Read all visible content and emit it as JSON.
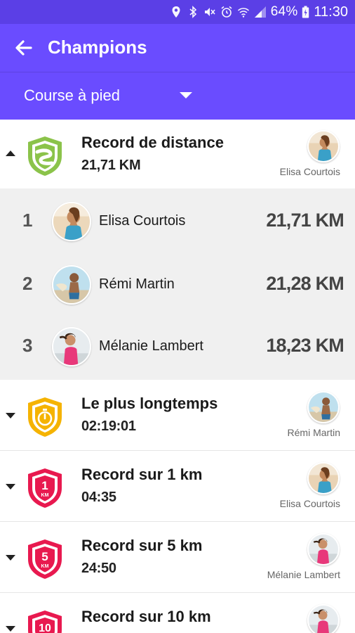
{
  "status_bar": {
    "battery_pct": "64%",
    "time": "11:30",
    "icons": [
      "location-icon",
      "bluetooth-icon",
      "mute-icon",
      "alarm-icon",
      "wifi-icon",
      "signal-icon",
      "battery-icon"
    ]
  },
  "app_bar": {
    "title": "Champions",
    "back_icon": "arrow-left-icon"
  },
  "filter": {
    "selected": "Course à pied"
  },
  "colors": {
    "primary": "#6a4cff",
    "primary_dark": "#5b3fe6",
    "badge_green": "#8bc34a",
    "badge_yellow": "#f5b301",
    "badge_red": "#e8194f"
  },
  "records": [
    {
      "title": "Record de distance",
      "value": "21,71 KM",
      "holder": "Elisa Courtois",
      "expanded": true,
      "badge": "road-badge-icon",
      "ranking": [
        {
          "rank": "1",
          "name": "Elisa Courtois",
          "value": "21,71 KM"
        },
        {
          "rank": "2",
          "name": "Rémi Martin",
          "value": "21,28 KM"
        },
        {
          "rank": "3",
          "name": "Mélanie Lambert",
          "value": "18,23 KM"
        }
      ]
    },
    {
      "title": "Le plus longtemps",
      "value": "02:19:01",
      "holder": "Rémi Martin",
      "expanded": false,
      "badge": "stopwatch-badge-icon"
    },
    {
      "title": "Record sur 1 km",
      "value": "04:35",
      "holder": "Elisa Courtois",
      "expanded": false,
      "badge": "1km-badge-icon",
      "badge_number": "1",
      "badge_unit": "KM"
    },
    {
      "title": "Record sur 5 km",
      "value": "24:50",
      "holder": "Mélanie Lambert",
      "expanded": false,
      "badge": "5km-badge-icon",
      "badge_number": "5",
      "badge_unit": "KM"
    },
    {
      "title": "Record sur 10 km",
      "value": "",
      "holder": "",
      "expanded": false,
      "badge": "10km-badge-icon",
      "badge_number": "10",
      "badge_unit": ""
    }
  ]
}
